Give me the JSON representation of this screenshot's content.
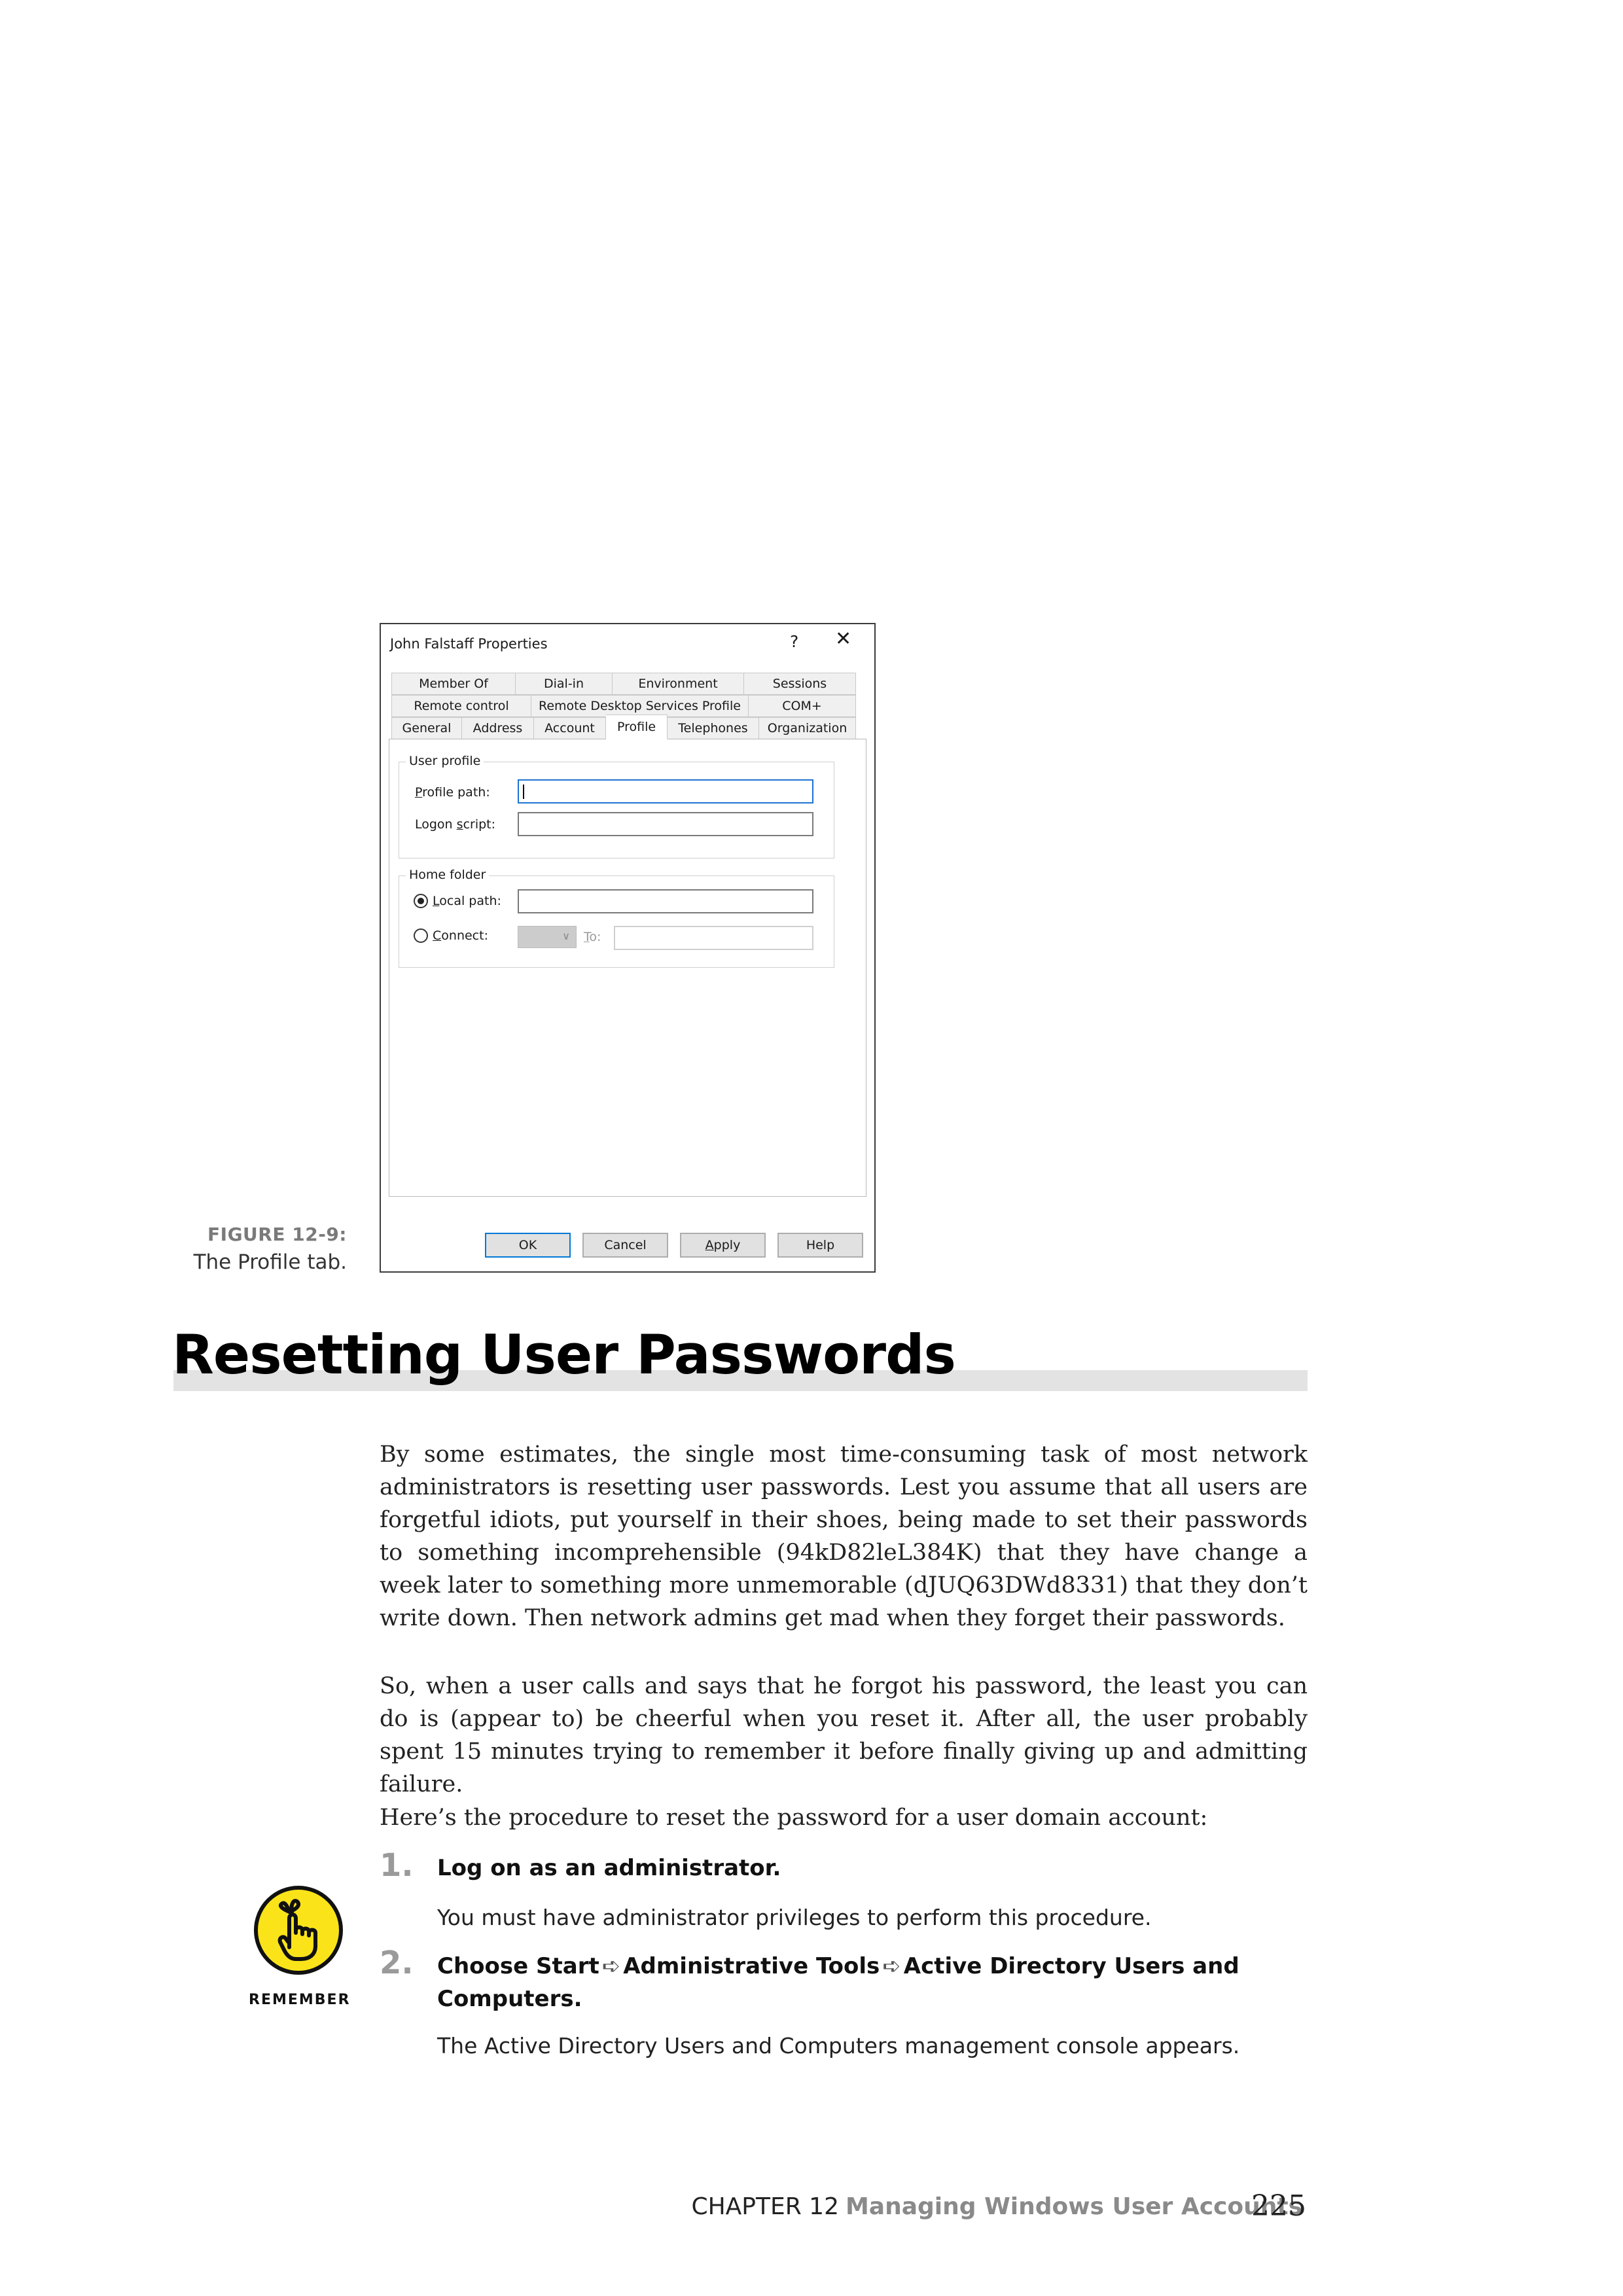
{
  "figure": {
    "number": "FIGURE 12-9:",
    "caption": "The Profile tab."
  },
  "dialog": {
    "title": "John Falstaff Properties",
    "help_glyph": "?",
    "close_glyph": "✕",
    "tabs_row1": [
      "Member Of",
      "Dial-in",
      "Environment",
      "Sessions"
    ],
    "tabs_row2": [
      "Remote control",
      "Remote Desktop Services Profile",
      "COM+"
    ],
    "tabs_row3": [
      "General",
      "Address",
      "Account",
      "Profile",
      "Telephones",
      "Organization"
    ],
    "active_tab": "Profile",
    "user_profile": {
      "legend": "User profile",
      "profile_path_label_first": "P",
      "profile_path_label_rest": "rofile path:",
      "profile_path_value": "",
      "logon_script_label_first": "Logon ",
      "logon_script_label_u": "s",
      "logon_script_label_rest": "cript:",
      "logon_script_value": ""
    },
    "home_folder": {
      "legend": "Home folder",
      "local_path_label_first": "L",
      "local_path_label_rest": "ocal path:",
      "local_path_selected": true,
      "local_path_value": "",
      "connect_label_first": "C",
      "connect_label_rest": "onnect:",
      "connect_selected": false,
      "drive_value": "",
      "to_label_first": "T",
      "to_label_rest": "o:",
      "to_value": ""
    },
    "buttons": {
      "ok": "OK",
      "cancel": "Cancel",
      "apply_first": "A",
      "apply_rest": "pply",
      "help": "Help"
    }
  },
  "section": {
    "heading": "Resetting User Passwords",
    "paragraphs": [
      "By some estimates, the single most time-consuming task of most network administrators is resetting user passwords. Lest you assume that all users are forgetful idiots, put yourself in their shoes, being made to set their passwords to something incomprehensible (94kD82leL384K) that they have change a week later to something more unmemorable (dJUQ63DWd8331) that they don’t write down. Then network admins get mad when they forget their passwords.",
      "So, when a user calls and says that he forgot his password, the least you can do is (appear to) be cheerful when you reset it. After all, the user probably spent 15 minutes trying to remember it before finally giving up and admitting failure.",
      "Here’s the procedure to reset the password for a user domain account:"
    ]
  },
  "remember_icon": {
    "label": "REMEMBER",
    "icon": "pointing-finger-with-string-icon",
    "color": "#fbe31a"
  },
  "steps": [
    {
      "number": "1.",
      "title": "Log on as an administrator.",
      "description": "You must have administrator privileges to perform this procedure."
    },
    {
      "number": "2.",
      "title_parts": [
        "Choose Start",
        "Administrative Tools",
        "Active Directory Users and Computers."
      ],
      "arrow_glyph": "➪",
      "description": "The Active Directory Users and Computers management console appears."
    }
  ],
  "footer": {
    "chapter": "CHAPTER 12",
    "title": "Managing Windows User Accounts",
    "page": "225"
  }
}
